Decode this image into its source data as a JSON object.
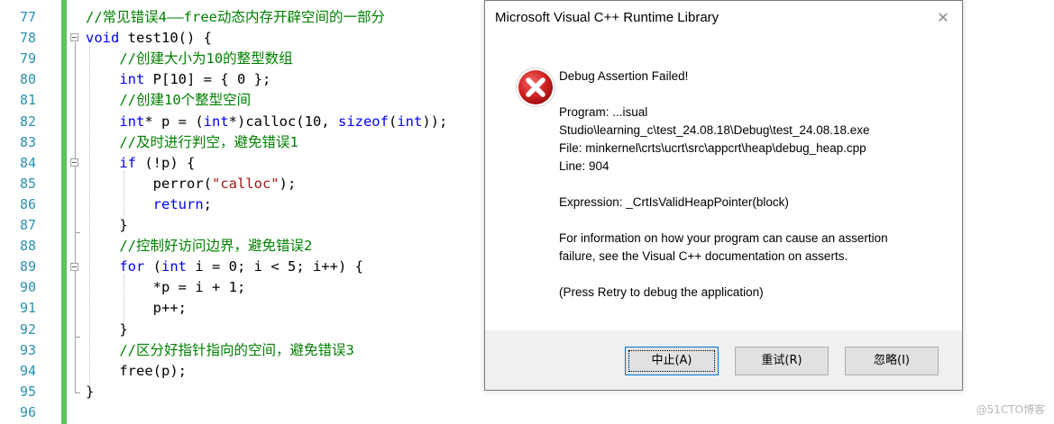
{
  "editor": {
    "lines": [
      {
        "n": "77",
        "tokens": [
          {
            "t": "//常见错误4——free动态内存开辟空间的一部分",
            "c": "comment"
          }
        ]
      },
      {
        "n": "78",
        "tokens": [
          {
            "t": "void",
            "c": "kw"
          },
          {
            "t": " test10() {",
            "c": "plain"
          }
        ]
      },
      {
        "n": "79",
        "tokens": [
          {
            "t": "    //创建大小为10的整型数组",
            "c": "comment"
          }
        ]
      },
      {
        "n": "80",
        "tokens": [
          {
            "t": "    ",
            "c": "plain"
          },
          {
            "t": "int",
            "c": "kw"
          },
          {
            "t": " P[10] = { 0 };",
            "c": "plain"
          }
        ]
      },
      {
        "n": "81",
        "tokens": [
          {
            "t": "    //创建10个整型空间",
            "c": "comment"
          }
        ]
      },
      {
        "n": "82",
        "tokens": [
          {
            "t": "    ",
            "c": "plain"
          },
          {
            "t": "int",
            "c": "kw"
          },
          {
            "t": "* p = (",
            "c": "plain"
          },
          {
            "t": "int",
            "c": "kw"
          },
          {
            "t": "*)calloc(10, ",
            "c": "plain"
          },
          {
            "t": "sizeof",
            "c": "kw"
          },
          {
            "t": "(",
            "c": "plain"
          },
          {
            "t": "int",
            "c": "kw"
          },
          {
            "t": "));",
            "c": "plain"
          }
        ]
      },
      {
        "n": "83",
        "tokens": [
          {
            "t": "    //及时进行判空，避免错误1",
            "c": "comment"
          }
        ]
      },
      {
        "n": "84",
        "tokens": [
          {
            "t": "    ",
            "c": "plain"
          },
          {
            "t": "if",
            "c": "kw"
          },
          {
            "t": " (!p) {",
            "c": "plain"
          }
        ]
      },
      {
        "n": "85",
        "tokens": [
          {
            "t": "        perror(",
            "c": "plain"
          },
          {
            "t": "\"calloc\"",
            "c": "str"
          },
          {
            "t": ");",
            "c": "plain"
          }
        ]
      },
      {
        "n": "86",
        "tokens": [
          {
            "t": "        ",
            "c": "plain"
          },
          {
            "t": "return",
            "c": "kw"
          },
          {
            "t": ";",
            "c": "plain"
          }
        ]
      },
      {
        "n": "87",
        "tokens": [
          {
            "t": "    }",
            "c": "plain"
          }
        ]
      },
      {
        "n": "88",
        "tokens": [
          {
            "t": "    //控制好访问边界，避免错误2",
            "c": "comment"
          }
        ]
      },
      {
        "n": "89",
        "tokens": [
          {
            "t": "    ",
            "c": "plain"
          },
          {
            "t": "for",
            "c": "kw"
          },
          {
            "t": " (",
            "c": "plain"
          },
          {
            "t": "int",
            "c": "kw"
          },
          {
            "t": " i = 0; i < 5; i++) {",
            "c": "plain"
          }
        ]
      },
      {
        "n": "90",
        "tokens": [
          {
            "t": "        *p = i + 1;",
            "c": "plain"
          }
        ]
      },
      {
        "n": "91",
        "tokens": [
          {
            "t": "        p++;",
            "c": "plain"
          }
        ]
      },
      {
        "n": "92",
        "tokens": [
          {
            "t": "    }",
            "c": "plain"
          }
        ]
      },
      {
        "n": "93",
        "tokens": [
          {
            "t": "    //区分好指针指向的空间，避免错误3",
            "c": "comment"
          }
        ]
      },
      {
        "n": "94",
        "tokens": [
          {
            "t": "    free(p);",
            "c": "plain"
          }
        ]
      },
      {
        "n": "95",
        "tokens": [
          {
            "t": "}",
            "c": "plain"
          }
        ]
      },
      {
        "n": "96",
        "tokens": []
      }
    ]
  },
  "dialog": {
    "title": "Microsoft Visual C++ Runtime Library",
    "close_glyph": "✕",
    "icon": "error-icon",
    "heading": "Debug Assertion Failed!",
    "program_line1": "Program: ...isual",
    "program_line2": "Studio\\learning_c\\test_24.08.18\\Debug\\test_24.08.18.exe",
    "file_line": "File: minkernel\\crts\\ucrt\\src\\appcrt\\heap\\debug_heap.cpp",
    "line_info": "Line: 904",
    "expression": "Expression: _CrtIsValidHeapPointer(block)",
    "info_line1": "For information on how your program can cause an assertion",
    "info_line2": "failure, see the Visual C++ documentation on asserts.",
    "retry_hint": "(Press Retry to debug the application)",
    "buttons": {
      "abort": "中止(A)",
      "retry": "重试(R)",
      "ignore": "忽略(I)"
    }
  },
  "watermark": "@51CTO博客",
  "colors": {
    "comment": "#008000",
    "keyword": "#0000ff",
    "string": "#a31515",
    "line_number": "#2b91af",
    "change_bar": "#5cc55c",
    "error_red": "#d32f2f"
  }
}
